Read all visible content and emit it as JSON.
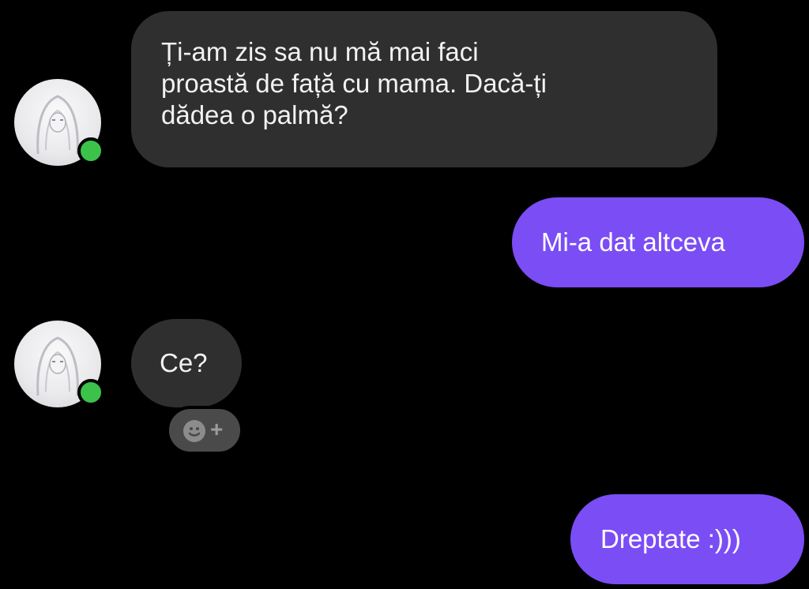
{
  "messages": [
    {
      "direction": "incoming",
      "text_line1": "Ți-am zis sa nu mă mai faci",
      "text_line2": "proastă de față cu mama. Dacă-ți",
      "text_line3": "dădea o palmă?"
    },
    {
      "direction": "outgoing",
      "text": "Mi-a dat altceva"
    },
    {
      "direction": "incoming",
      "text": "Ce?"
    },
    {
      "direction": "outgoing",
      "text": "Dreptate :)))"
    }
  ],
  "reaction_button": {
    "icon": "smiley-plus-icon",
    "symbol": "+"
  },
  "colors": {
    "background": "#000000",
    "incoming_bubble": "#2f2f2f",
    "outgoing_bubble": "#7b4df5",
    "presence": "#3cc24a"
  }
}
